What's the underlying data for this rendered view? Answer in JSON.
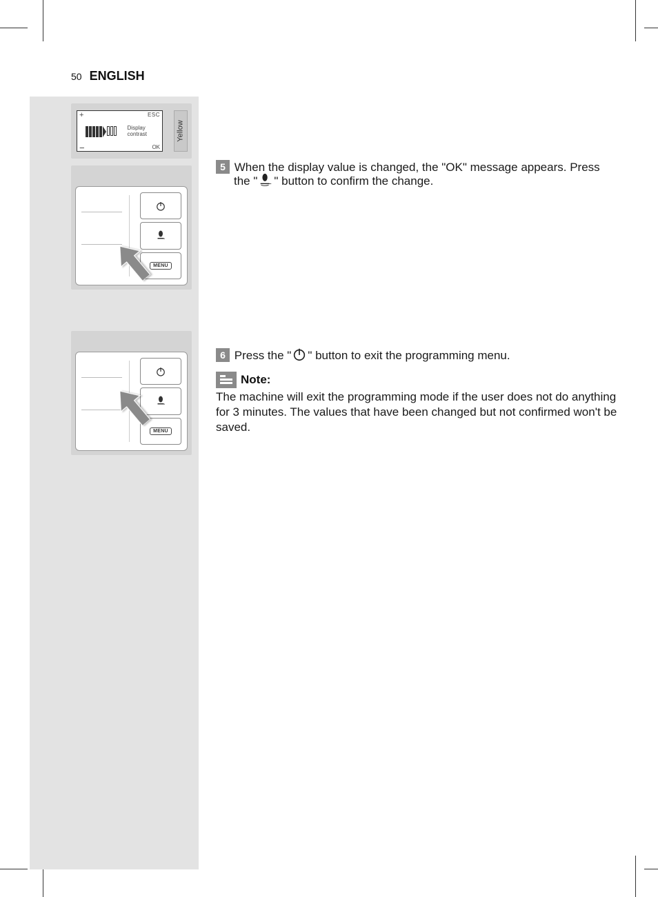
{
  "header": {
    "page_number": "50",
    "language": "ENGLISH"
  },
  "figures": {
    "fig1": {
      "display": {
        "plus": "+",
        "minus": "−",
        "esc": "ESC",
        "ok": "OK",
        "label_line1": "Display",
        "label_line2": "contrast"
      },
      "tab": "Yellow"
    },
    "fig2": {
      "buttons": {
        "power": "power-icon",
        "coffee": "coffee-icon",
        "menu": "MENU"
      }
    },
    "fig3": {
      "buttons": {
        "power": "power-icon",
        "coffee": "coffee-icon",
        "menu": "MENU"
      }
    }
  },
  "steps": {
    "s5": {
      "num": "5",
      "text_a": "When the display value is changed, the \"OK\" message appears. Press",
      "text_b1": "the \"",
      "text_b2": "\" button to confirm the change.",
      "icon": "coffee-cup-icon"
    },
    "s6": {
      "num": "6",
      "text_a": "Press the \"",
      "text_b": "\" button to exit the programming menu.",
      "icon": "power-icon"
    }
  },
  "note": {
    "label": "Note:",
    "body": "The machine will exit the programming mode if the user does not do anything for 3 minutes. The values that have been changed but not confirmed won't be saved."
  }
}
